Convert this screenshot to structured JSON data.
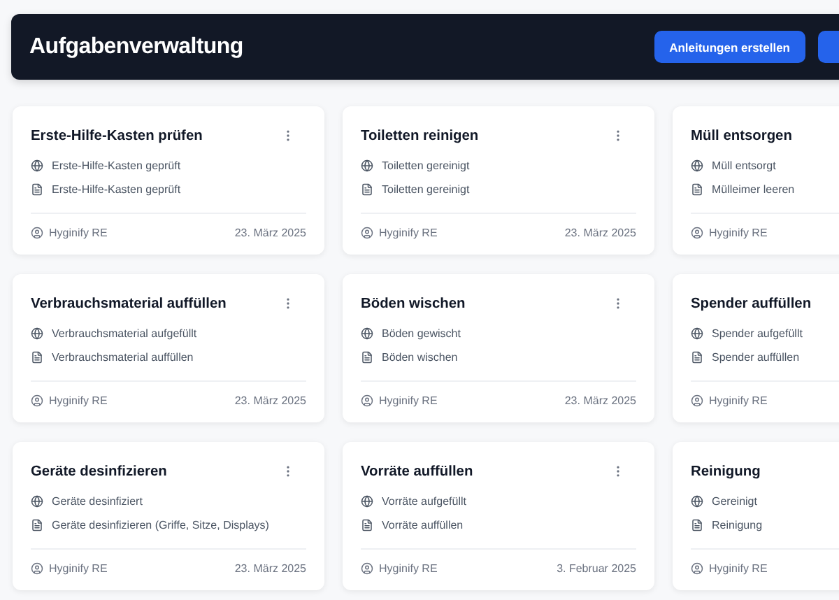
{
  "header": {
    "title": "Aufgabenverwaltung",
    "buttons": [
      {
        "kind": "labeled",
        "label": "Anleitungen erstellen"
      },
      {
        "kind": "cut"
      }
    ]
  },
  "cards": [
    {
      "title": "Erste-Hilfe-Kasten prüfen",
      "result": "Erste-Hilfe-Kasten geprüft",
      "instruction": "Erste-Hilfe-Kasten geprüft",
      "author": "Hyginify RE",
      "date": "23. März 2025"
    },
    {
      "title": "Toiletten reinigen",
      "result": "Toiletten gereinigt",
      "instruction": "Toiletten gereinigt",
      "author": "Hyginify RE",
      "date": "23. März 2025"
    },
    {
      "title": "Müll entsorgen",
      "result": "Müll entsorgt",
      "instruction": "Mülleimer leeren",
      "author": "Hyginify RE"
    },
    {
      "title": "Verbrauchsmaterial auffüllen",
      "result": "Verbrauchsmaterial aufgefüllt",
      "instruction": "Verbrauchsmaterial auffüllen",
      "author": "Hyginify RE",
      "date": "23. März 2025"
    },
    {
      "title": "Böden wischen",
      "result": "Böden gewischt",
      "instruction": "Böden wischen",
      "author": "Hyginify RE",
      "date": "23. März 2025"
    },
    {
      "title": "Spender auffüllen",
      "result": "Spender aufgefüllt",
      "instruction": "Spender auffüllen",
      "author": "Hyginify RE"
    },
    {
      "title": "Geräte desinfizieren",
      "result": "Geräte desinfiziert",
      "instruction": "Geräte desinfizieren (Griffe, Sitze, Displays)",
      "author": "Hyginify RE",
      "date": "23. März 2025"
    },
    {
      "title": "Vorräte auffüllen",
      "result": "Vorräte aufgefüllt",
      "instruction": "Vorräte auffüllen",
      "author": "Hyginify RE",
      "date": "3. Februar 2025"
    },
    {
      "title": "Reinigung",
      "result": "Gereinigt",
      "instruction": "Reinigung",
      "author": "Hyginify RE"
    }
  ]
}
